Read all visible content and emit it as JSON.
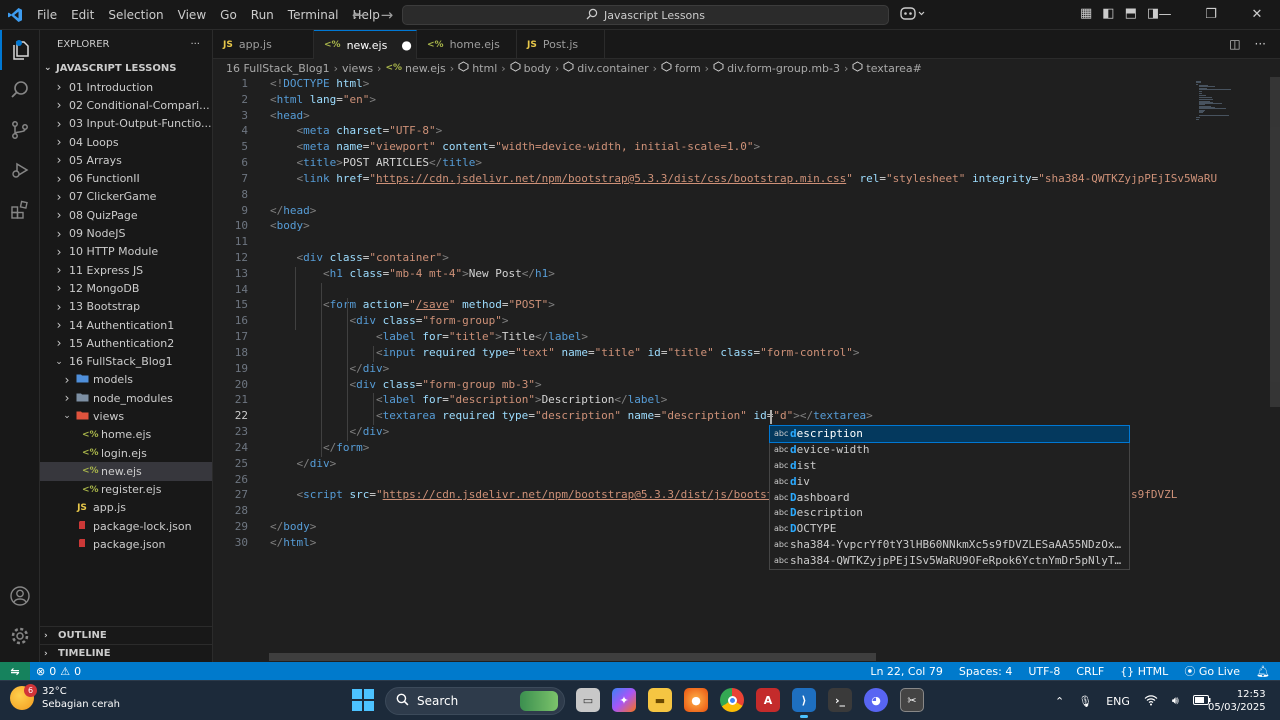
{
  "window": {
    "menu": [
      "File",
      "Edit",
      "Selection",
      "View",
      "Go",
      "Run",
      "Terminal",
      "Help"
    ],
    "search": "Javascript Lessons"
  },
  "explorer": {
    "header": "EXPLORER",
    "project": "JAVASCRIPT LESSONS",
    "items": [
      {
        "label": "01 Introduction",
        "kind": "folder",
        "depth": 1,
        "open": false
      },
      {
        "label": "02 Conditional-Compari...",
        "kind": "folder",
        "depth": 1,
        "open": false
      },
      {
        "label": "03 Input-Output-Functio...",
        "kind": "folder",
        "depth": 1,
        "open": false
      },
      {
        "label": "04 Loops",
        "kind": "folder",
        "depth": 1,
        "open": false
      },
      {
        "label": "05 Arrays",
        "kind": "folder",
        "depth": 1,
        "open": false
      },
      {
        "label": "06 FunctionII",
        "kind": "folder",
        "depth": 1,
        "open": false
      },
      {
        "label": "07 ClickerGame",
        "kind": "folder",
        "depth": 1,
        "open": false
      },
      {
        "label": "08 QuizPage",
        "kind": "folder",
        "depth": 1,
        "open": false
      },
      {
        "label": "09 NodeJS",
        "kind": "folder",
        "depth": 1,
        "open": false
      },
      {
        "label": "10 HTTP Module",
        "kind": "folder",
        "depth": 1,
        "open": false
      },
      {
        "label": "11 Express JS",
        "kind": "folder",
        "depth": 1,
        "open": false
      },
      {
        "label": "12 MongoDB",
        "kind": "folder",
        "depth": 1,
        "open": false
      },
      {
        "label": "13 Bootstrap",
        "kind": "folder",
        "depth": 1,
        "open": false
      },
      {
        "label": "14 Authentication1",
        "kind": "folder",
        "depth": 1,
        "open": false
      },
      {
        "label": "15 Authentication2",
        "kind": "folder",
        "depth": 1,
        "open": false
      },
      {
        "label": "16 FullStack_Blog1",
        "kind": "folder",
        "depth": 1,
        "open": true
      },
      {
        "label": "models",
        "kind": "special-folder",
        "depth": 2,
        "open": false,
        "color": "#4f8fda"
      },
      {
        "label": "node_modules",
        "kind": "special-folder",
        "depth": 2,
        "open": false,
        "color": "#7d8fa3"
      },
      {
        "label": "views",
        "kind": "special-folder",
        "depth": 2,
        "open": true,
        "color": "#e0533d"
      },
      {
        "label": "home.ejs",
        "kind": "ejs",
        "depth": 3
      },
      {
        "label": "login.ejs",
        "kind": "ejs",
        "depth": 3
      },
      {
        "label": "new.ejs",
        "kind": "ejs",
        "depth": 3,
        "selected": true
      },
      {
        "label": "register.ejs",
        "kind": "ejs",
        "depth": 3
      },
      {
        "label": "app.js",
        "kind": "js",
        "depth": 2
      },
      {
        "label": "package-lock.json",
        "kind": "json",
        "depth": 2
      },
      {
        "label": "package.json",
        "kind": "json",
        "depth": 2
      }
    ],
    "outline": "OUTLINE",
    "timeline": "TIMELINE"
  },
  "tabs": [
    {
      "label": "app.js",
      "icon": "JS",
      "active": false,
      "dirty": false
    },
    {
      "label": "new.ejs",
      "icon": "<%",
      "active": true,
      "dirty": true
    },
    {
      "label": "home.ejs",
      "icon": "<%",
      "active": false,
      "dirty": false
    },
    {
      "label": "Post.js",
      "icon": "JS",
      "active": false,
      "dirty": false
    }
  ],
  "breadcrumb": [
    "16 FullStack_Blog1",
    "views",
    "new.ejs",
    "html",
    "body",
    "div.container",
    "form",
    "div.form-group.mb-3",
    "textarea#"
  ],
  "editor": {
    "current_line": 22,
    "lines": [
      [
        [
          "br",
          "<!"
        ],
        [
          "tag",
          "DOCTYPE"
        ],
        [
          "text",
          " "
        ],
        [
          "attr",
          "html"
        ],
        [
          "br",
          ">"
        ]
      ],
      [
        [
          "br",
          "<"
        ],
        [
          "tag",
          "html"
        ],
        [
          "text",
          " "
        ],
        [
          "attr",
          "lang"
        ],
        [
          "text",
          "="
        ],
        [
          "str",
          "\"en\""
        ],
        [
          "br",
          ">"
        ]
      ],
      [
        [
          "br",
          "<"
        ],
        [
          "tag",
          "head"
        ],
        [
          "br",
          ">"
        ]
      ],
      [
        [
          "text",
          "    "
        ],
        [
          "br",
          "<"
        ],
        [
          "tag",
          "meta"
        ],
        [
          "text",
          " "
        ],
        [
          "attr",
          "charset"
        ],
        [
          "text",
          "="
        ],
        [
          "str",
          "\"UTF-8\""
        ],
        [
          "br",
          ">"
        ]
      ],
      [
        [
          "text",
          "    "
        ],
        [
          "br",
          "<"
        ],
        [
          "tag",
          "meta"
        ],
        [
          "text",
          " "
        ],
        [
          "attr",
          "name"
        ],
        [
          "text",
          "="
        ],
        [
          "str",
          "\"viewport\""
        ],
        [
          "text",
          " "
        ],
        [
          "attr",
          "content"
        ],
        [
          "text",
          "="
        ],
        [
          "str",
          "\"width=device-width, initial-scale=1.0\""
        ],
        [
          "br",
          ">"
        ]
      ],
      [
        [
          "text",
          "    "
        ],
        [
          "br",
          "<"
        ],
        [
          "tag",
          "title"
        ],
        [
          "br",
          ">"
        ],
        [
          "text",
          "POST ARTICLES"
        ],
        [
          "br",
          "</"
        ],
        [
          "tag",
          "title"
        ],
        [
          "br",
          ">"
        ]
      ],
      [
        [
          "text",
          "    "
        ],
        [
          "br",
          "<"
        ],
        [
          "tag",
          "link"
        ],
        [
          "text",
          " "
        ],
        [
          "attr",
          "href"
        ],
        [
          "text",
          "="
        ],
        [
          "str",
          "\""
        ],
        [
          "url",
          "https://cdn.jsdelivr.net/npm/bootstrap@5.3.3/dist/css/bootstrap.min.css"
        ],
        [
          "str",
          "\""
        ],
        [
          "text",
          " "
        ],
        [
          "attr",
          "rel"
        ],
        [
          "text",
          "="
        ],
        [
          "str",
          "\"stylesheet\""
        ],
        [
          "text",
          " "
        ],
        [
          "attr",
          "integrity"
        ],
        [
          "text",
          "="
        ],
        [
          "str",
          "\"sha384-QWTKZyjpPEjISv5WaRU"
        ]
      ],
      [],
      [
        [
          "br",
          "</"
        ],
        [
          "tag",
          "head"
        ],
        [
          "br",
          ">"
        ]
      ],
      [
        [
          "br",
          "<"
        ],
        [
          "tag",
          "body"
        ],
        [
          "br",
          ">"
        ]
      ],
      [],
      [
        [
          "text",
          "    "
        ],
        [
          "br",
          "<"
        ],
        [
          "tag",
          "div"
        ],
        [
          "text",
          " "
        ],
        [
          "attr",
          "class"
        ],
        [
          "text",
          "="
        ],
        [
          "str",
          "\"container\""
        ],
        [
          "br",
          ">"
        ]
      ],
      [
        [
          "text",
          "        "
        ],
        [
          "br",
          "<"
        ],
        [
          "tag",
          "h1"
        ],
        [
          "text",
          " "
        ],
        [
          "attr",
          "class"
        ],
        [
          "text",
          "="
        ],
        [
          "str",
          "\"mb-4 mt-4\""
        ],
        [
          "br",
          ">"
        ],
        [
          "text",
          "New Post"
        ],
        [
          "br",
          "</"
        ],
        [
          "tag",
          "h1"
        ],
        [
          "br",
          ">"
        ]
      ],
      [],
      [
        [
          "text",
          "        "
        ],
        [
          "br",
          "<"
        ],
        [
          "tag",
          "form"
        ],
        [
          "text",
          " "
        ],
        [
          "attr",
          "action"
        ],
        [
          "text",
          "="
        ],
        [
          "str",
          "\""
        ],
        [
          "url",
          "/save"
        ],
        [
          "str",
          "\""
        ],
        [
          "text",
          " "
        ],
        [
          "attr",
          "method"
        ],
        [
          "text",
          "="
        ],
        [
          "str",
          "\"POST\""
        ],
        [
          "br",
          ">"
        ]
      ],
      [
        [
          "text",
          "            "
        ],
        [
          "br",
          "<"
        ],
        [
          "tag",
          "div"
        ],
        [
          "text",
          " "
        ],
        [
          "attr",
          "class"
        ],
        [
          "text",
          "="
        ],
        [
          "str",
          "\"form-group\""
        ],
        [
          "br",
          ">"
        ]
      ],
      [
        [
          "text",
          "                "
        ],
        [
          "br",
          "<"
        ],
        [
          "tag",
          "label"
        ],
        [
          "text",
          " "
        ],
        [
          "attr",
          "for"
        ],
        [
          "text",
          "="
        ],
        [
          "str",
          "\"title\""
        ],
        [
          "br",
          ">"
        ],
        [
          "text",
          "Title"
        ],
        [
          "br",
          "</"
        ],
        [
          "tag",
          "label"
        ],
        [
          "br",
          ">"
        ]
      ],
      [
        [
          "text",
          "                "
        ],
        [
          "br",
          "<"
        ],
        [
          "tag",
          "input"
        ],
        [
          "text",
          " "
        ],
        [
          "attr",
          "required"
        ],
        [
          "text",
          " "
        ],
        [
          "attr",
          "type"
        ],
        [
          "text",
          "="
        ],
        [
          "str",
          "\"text\""
        ],
        [
          "text",
          " "
        ],
        [
          "attr",
          "name"
        ],
        [
          "text",
          "="
        ],
        [
          "str",
          "\"title\""
        ],
        [
          "text",
          " "
        ],
        [
          "attr",
          "id"
        ],
        [
          "text",
          "="
        ],
        [
          "str",
          "\"title\""
        ],
        [
          "text",
          " "
        ],
        [
          "attr",
          "class"
        ],
        [
          "text",
          "="
        ],
        [
          "str",
          "\"form-control\""
        ],
        [
          "br",
          ">"
        ]
      ],
      [
        [
          "text",
          "            "
        ],
        [
          "br",
          "</"
        ],
        [
          "tag",
          "div"
        ],
        [
          "br",
          ">"
        ]
      ],
      [
        [
          "text",
          "            "
        ],
        [
          "br",
          "<"
        ],
        [
          "tag",
          "div"
        ],
        [
          "text",
          " "
        ],
        [
          "attr",
          "class"
        ],
        [
          "text",
          "="
        ],
        [
          "str",
          "\"form-group mb-3\""
        ],
        [
          "br",
          ">"
        ]
      ],
      [
        [
          "text",
          "                "
        ],
        [
          "br",
          "<"
        ],
        [
          "tag",
          "label"
        ],
        [
          "text",
          " "
        ],
        [
          "attr",
          "for"
        ],
        [
          "text",
          "="
        ],
        [
          "str",
          "\"description\""
        ],
        [
          "br",
          ">"
        ],
        [
          "text",
          "Description"
        ],
        [
          "br",
          "</"
        ],
        [
          "tag",
          "label"
        ],
        [
          "br",
          ">"
        ]
      ],
      [
        [
          "text",
          "                "
        ],
        [
          "br",
          "<"
        ],
        [
          "tag",
          "textarea"
        ],
        [
          "text",
          " "
        ],
        [
          "attr",
          "required"
        ],
        [
          "text",
          " "
        ],
        [
          "attr",
          "type"
        ],
        [
          "text",
          "="
        ],
        [
          "str",
          "\"description\""
        ],
        [
          "text",
          " "
        ],
        [
          "attr",
          "name"
        ],
        [
          "text",
          "="
        ],
        [
          "str",
          "\"description\""
        ],
        [
          "text",
          " "
        ],
        [
          "attr",
          "id"
        ],
        [
          "text",
          "="
        ],
        [
          "str",
          "\"d\""
        ],
        [
          "br",
          ">"
        ],
        [
          "br",
          "</"
        ],
        [
          "tag",
          "textarea"
        ],
        [
          "br",
          ">"
        ]
      ],
      [
        [
          "text",
          "            "
        ],
        [
          "br",
          "</"
        ],
        [
          "tag",
          "div"
        ],
        [
          "br",
          ">"
        ]
      ],
      [
        [
          "text",
          "        "
        ],
        [
          "br",
          "</"
        ],
        [
          "tag",
          "form"
        ],
        [
          "br",
          ">"
        ]
      ],
      [
        [
          "text",
          "    "
        ],
        [
          "br",
          "</"
        ],
        [
          "tag",
          "div"
        ],
        [
          "br",
          ">"
        ]
      ],
      [],
      [
        [
          "text",
          "    "
        ],
        [
          "br",
          "<"
        ],
        [
          "tag",
          "script"
        ],
        [
          "text",
          " "
        ],
        [
          "attr",
          "src"
        ],
        [
          "text",
          "="
        ],
        [
          "str",
          "\""
        ],
        [
          "url",
          "https://cdn.jsdelivr.net/npm/bootstrap@5.3.3/dist/js/bootstra"
        ],
        [
          "text",
          "                                                  "
        ],
        [
          "str",
          "c5s9fDVZL"
        ]
      ],
      [],
      [
        [
          "br",
          "</"
        ],
        [
          "tag",
          "body"
        ],
        [
          "br",
          ">"
        ]
      ],
      [
        [
          "br",
          "</"
        ],
        [
          "tag",
          "html"
        ],
        [
          "br",
          ">"
        ]
      ]
    ]
  },
  "suggestions": {
    "kind_label": "abc",
    "items": [
      {
        "label": "description",
        "match": "d",
        "focused": true
      },
      {
        "label": "device-width",
        "match": "d",
        "focused": false
      },
      {
        "label": "dist",
        "match": "d",
        "focused": false
      },
      {
        "label": "div",
        "match": "d",
        "focused": false
      },
      {
        "label": "Dashboard",
        "match": "D",
        "focused": false
      },
      {
        "label": "Description",
        "match": "D",
        "focused": false
      },
      {
        "label": "DOCTYPE",
        "match": "D",
        "focused": false
      },
      {
        "label": "sha384-YvpcrYf0tY3lHB60NNkmXc5s9fDVZLESaAA55NDzOx…",
        "match": "",
        "focused": false
      },
      {
        "label": "sha384-QWTKZyjpPEjISv5WaRU9OFeRpok6YctnYmDr5pNlyT…",
        "match": "",
        "focused": false
      }
    ]
  },
  "statusbar": {
    "problems": "0",
    "warnings": "0",
    "position": "Ln 22, Col 79",
    "spaces": "Spaces: 4",
    "encoding": "UTF-8",
    "eol": "CRLF",
    "language": "HTML",
    "golive": "Go Live"
  },
  "taskbar": {
    "temperature": "32°C",
    "weather": "Sebagian cerah",
    "weather_badge": "6",
    "search": "Search",
    "lang": "ENG",
    "time": "12:53",
    "date": "05/03/2025"
  },
  "colors": {
    "accent": "#0078d4",
    "statusbar": "#007acc",
    "tag": "#569cd6",
    "attr": "#9cdcfe",
    "string": "#ce9178"
  }
}
